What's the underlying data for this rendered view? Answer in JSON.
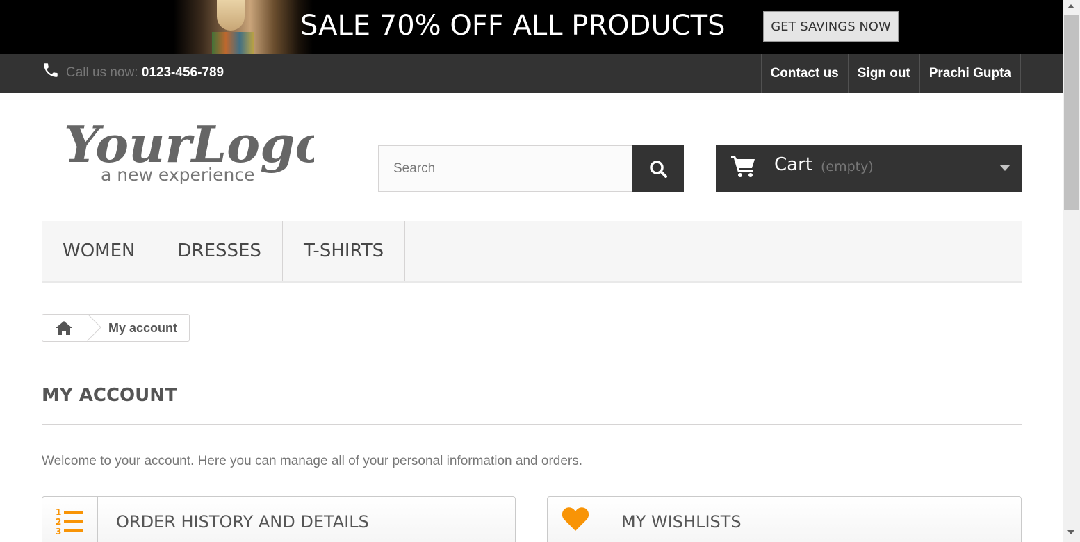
{
  "banner": {
    "title": "SALE 70% OFF ALL PRODUCTS",
    "cta_label": "GET SAVINGS NOW"
  },
  "topbar": {
    "call_prefix": "Call us now: ",
    "phone_number": "0123-456-789",
    "links": [
      {
        "label": "Contact us"
      },
      {
        "label": "Sign out"
      },
      {
        "label": "Prachi Gupta"
      }
    ]
  },
  "header": {
    "logo_text": "YourLogo",
    "logo_tagline": "a new experience",
    "search_placeholder": "Search",
    "cart_label": "Cart",
    "cart_status": "(empty)"
  },
  "menu": {
    "items": [
      {
        "label": "WOMEN"
      },
      {
        "label": "DRESSES"
      },
      {
        "label": "T-SHIRTS"
      }
    ]
  },
  "breadcrumb": {
    "current": "My account"
  },
  "content": {
    "heading": "MY ACCOUNT",
    "welcome": "Welcome to your account. Here you can manage all of your personal information and orders.",
    "blocks": [
      {
        "label": "ORDER HISTORY AND DETAILS",
        "icon": "ordered-list-icon"
      },
      {
        "label": "MY WISHLISTS",
        "icon": "heart-icon"
      }
    ]
  },
  "colors": {
    "dark": "#333333",
    "accent_orange": "#f89406",
    "menu_bg": "#f6f6f6"
  }
}
